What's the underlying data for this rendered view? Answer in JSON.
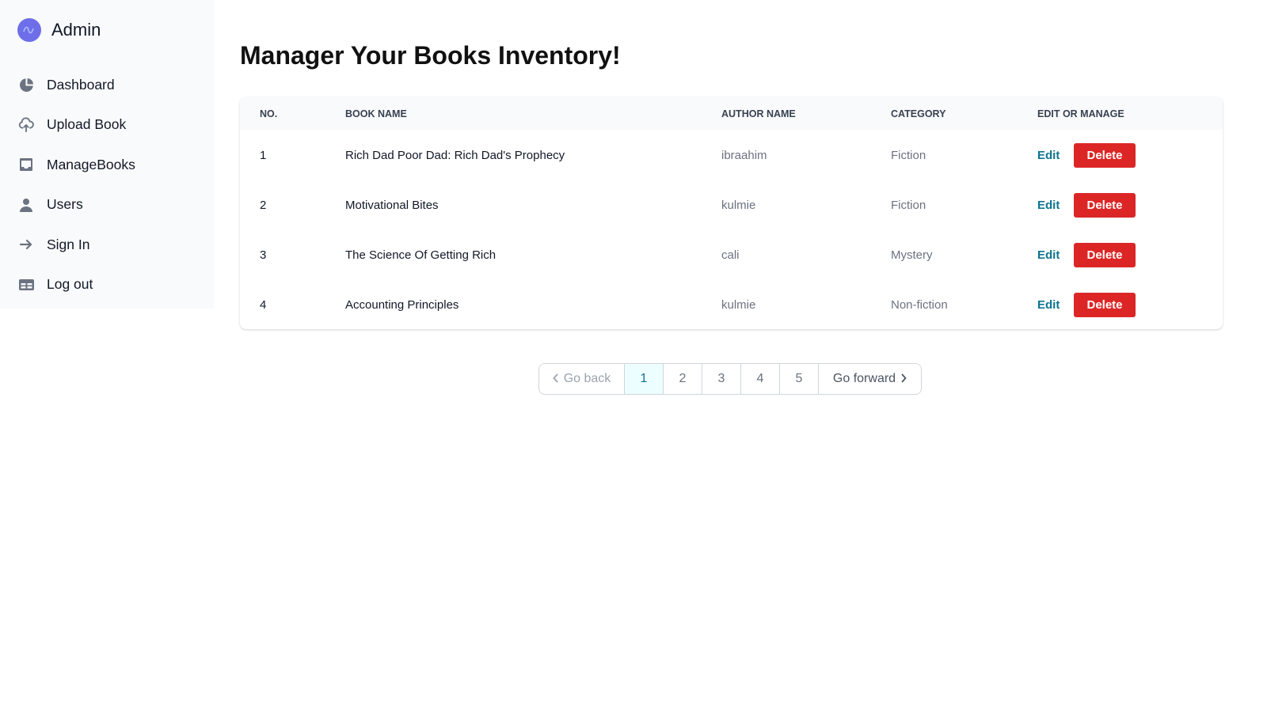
{
  "sidebar": {
    "brand": "Admin",
    "items": [
      {
        "label": "Dashboard",
        "icon": "pie-chart-icon"
      },
      {
        "label": "Upload Book",
        "icon": "cloud-upload-icon"
      },
      {
        "label": "ManageBooks",
        "icon": "inbox-icon"
      },
      {
        "label": "Users",
        "icon": "user-icon"
      },
      {
        "label": "Sign In",
        "icon": "arrow-right-icon"
      },
      {
        "label": "Log out",
        "icon": "table-icon"
      }
    ]
  },
  "main": {
    "title": "Manager Your Books Inventory!"
  },
  "table": {
    "headers": [
      "NO.",
      "BOOK NAME",
      "AUTHOR NAME",
      "CATEGORY",
      "EDIT OR MANAGE"
    ],
    "rows": [
      {
        "no": "1",
        "name": "Rich Dad Poor Dad: Rich Dad's Prophecy",
        "author": "ibraahim",
        "category": "Fiction"
      },
      {
        "no": "2",
        "name": "Motivational Bites",
        "author": "kulmie",
        "category": "Fiction"
      },
      {
        "no": "3",
        "name": "The Science Of Getting Rich",
        "author": "cali",
        "category": "Mystery"
      },
      {
        "no": "4",
        "name": "Accounting Principles",
        "author": "kulmie",
        "category": "Non-fiction"
      }
    ],
    "edit_label": "Edit",
    "delete_label": "Delete"
  },
  "pagination": {
    "back_label": "Go back",
    "forward_label": "Go forward",
    "pages": [
      "1",
      "2",
      "3",
      "4",
      "5"
    ],
    "current": "1"
  },
  "colors": {
    "accent": "#0e7490",
    "danger": "#dc2626",
    "brand": "#6d6ee8"
  }
}
